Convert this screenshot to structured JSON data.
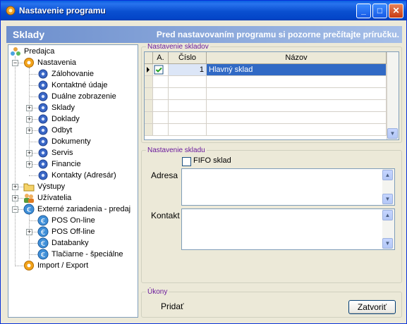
{
  "window": {
    "title": "Nastavenie programu",
    "controls": {
      "minimize": "_",
      "maximize": "□",
      "close": "✕"
    }
  },
  "header": {
    "title": "Sklady",
    "note": "Pred nastavovaním programu si pozorne prečítajte príručku."
  },
  "tree": {
    "root": "Predajca",
    "items": [
      {
        "label": "Nastavenia",
        "icon": "gear-orange-icon",
        "expander": "−"
      },
      {
        "label": "Zálohovanie",
        "icon": "gear-blue-icon"
      },
      {
        "label": "Kontaktné údaje",
        "icon": "gear-blue-icon"
      },
      {
        "label": "Duálne zobrazenie",
        "icon": "gear-blue-icon"
      },
      {
        "label": "Sklady",
        "icon": "gear-blue-icon",
        "expander": "+"
      },
      {
        "label": "Doklady",
        "icon": "gear-blue-icon",
        "expander": "+"
      },
      {
        "label": "Odbyt",
        "icon": "gear-blue-icon",
        "expander": "+"
      },
      {
        "label": "Dokumenty",
        "icon": "gear-blue-icon"
      },
      {
        "label": "Servis",
        "icon": "gear-blue-icon",
        "expander": "+"
      },
      {
        "label": "Financie",
        "icon": "gear-blue-icon",
        "expander": "+"
      },
      {
        "label": "Kontakty (Adresár)",
        "icon": "gear-blue-icon"
      },
      {
        "label": "Výstupy",
        "icon": "folder-icon",
        "expander": "+"
      },
      {
        "label": "Užívatelia",
        "icon": "users-icon",
        "expander": "+"
      },
      {
        "label": "Externé zariadenia - predaj",
        "icon": "euro-icon",
        "expander": "−"
      },
      {
        "label": "POS On-line",
        "icon": "euro-icon"
      },
      {
        "label": "POS Off-line",
        "icon": "euro-icon",
        "expander": "+"
      },
      {
        "label": "Databanky",
        "icon": "euro-icon"
      },
      {
        "label": "Tlačiarne - špeciálne",
        "icon": "euro-icon"
      },
      {
        "label": "Import / Export",
        "icon": "gear-orange-icon"
      }
    ]
  },
  "warehouses": {
    "legend": "Nastavenie skladov",
    "columns": [
      "A.",
      "Číslo",
      "Názov"
    ],
    "rows": [
      {
        "active": true,
        "number": "1",
        "name": "Hlavný sklad"
      }
    ]
  },
  "warehouse_settings": {
    "legend": "Nastavenie skladu",
    "fifo_label": "FIFO sklad",
    "fifo_checked": false,
    "address_label": "Adresa",
    "address_value": "",
    "contact_label": "Kontakt",
    "contact_value": ""
  },
  "actions": {
    "legend": "Úkony",
    "add_label": "Pridať",
    "close_label": "Zatvoriť"
  }
}
